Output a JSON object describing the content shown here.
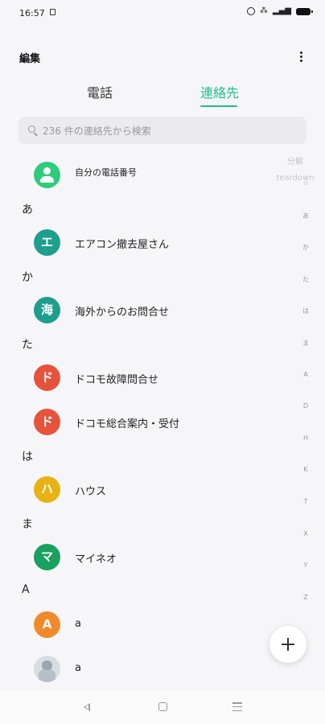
{
  "status_bar": {
    "time": "16:57"
  },
  "header": {
    "edit_label": "編集"
  },
  "tabs": [
    {
      "label": "電話",
      "active": false
    },
    {
      "label": "連絡先",
      "active": true
    }
  ],
  "search": {
    "placeholder": "236 件の連絡先から検索"
  },
  "my_number": {
    "label": "自分の電話番号"
  },
  "sections": [
    {
      "header": "あ",
      "contacts": [
        {
          "initial": "エ",
          "name": "エアコン撤去屋さん",
          "color": "#1e9e8c"
        }
      ]
    },
    {
      "header": "か",
      "contacts": [
        {
          "initial": "海",
          "name": "海外からのお問合せ",
          "color": "#1e9e8c"
        }
      ]
    },
    {
      "header": "た",
      "contacts": [
        {
          "initial": "ド",
          "name": "ドコモ故障問合せ",
          "color": "#e5533d"
        },
        {
          "initial": "ド",
          "name": "ドコモ総合案内・受付",
          "color": "#e5533d"
        }
      ]
    },
    {
      "header": "は",
      "contacts": [
        {
          "initial": "ハ",
          "name": "ハウス",
          "color": "#e8b215"
        }
      ]
    },
    {
      "header": "ま",
      "contacts": [
        {
          "initial": "マ",
          "name": "マイネオ",
          "color": "#1aa060"
        }
      ]
    },
    {
      "header": "A",
      "contacts": [
        {
          "initial": "A",
          "name": "a",
          "color": "#f08a2a"
        },
        {
          "initial": "",
          "name": "a",
          "color": "#d8dde2",
          "photo": true
        }
      ]
    }
  ],
  "teardown_note": {
    "line1": "分解",
    "line2": "teardown"
  },
  "index_bar": [
    "☆",
    "あ",
    "か",
    "た",
    "は",
    "ま",
    "A",
    "D",
    "H",
    "K",
    "T",
    "X",
    "Y",
    "Z"
  ],
  "colors": {
    "accent": "#1fbf8a",
    "me_avatar": "#2ecc7a"
  }
}
